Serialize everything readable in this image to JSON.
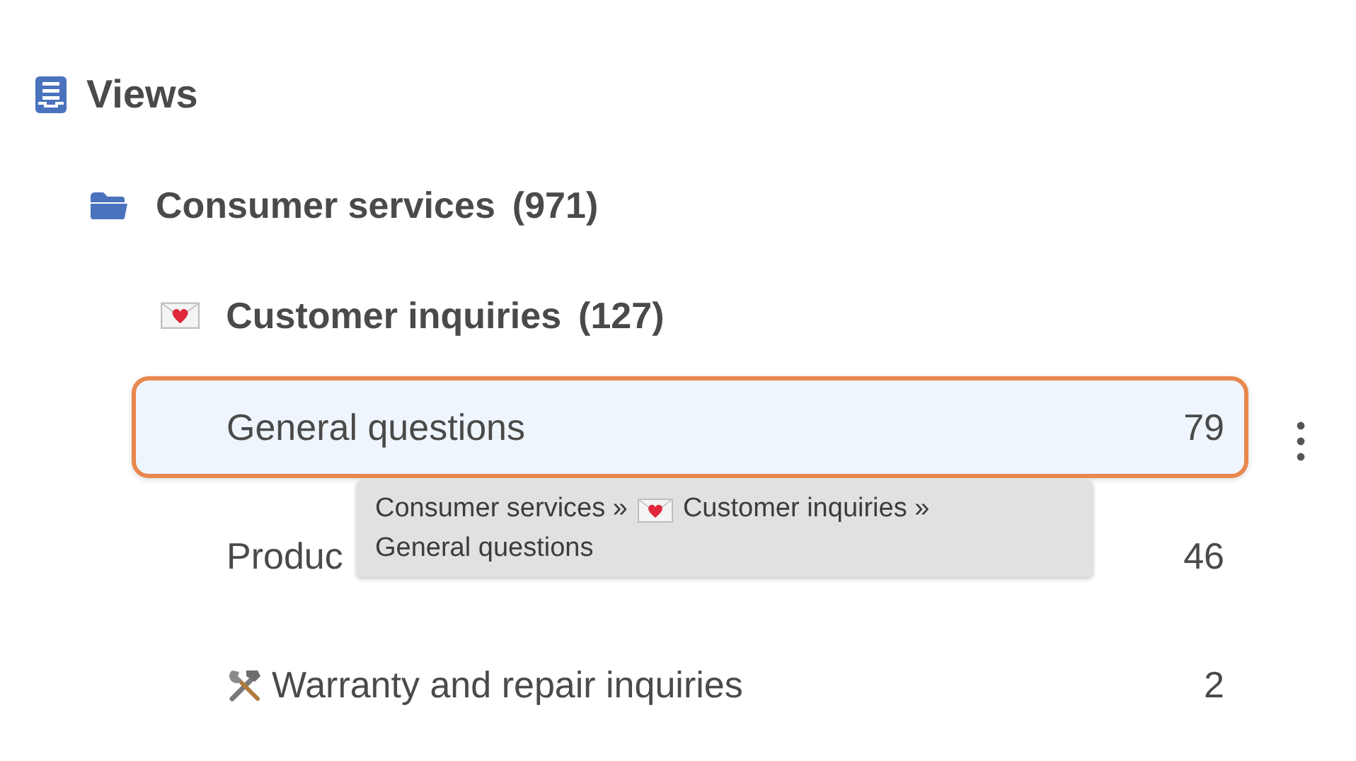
{
  "views": {
    "label": "Views",
    "children": [
      {
        "kind": "folder",
        "label": "Consumer services",
        "count": "(971)",
        "children": [
          {
            "kind": "category",
            "label": "Customer inquiries",
            "count": "(127)",
            "children": [
              {
                "kind": "view",
                "label": "General questions",
                "count": "79",
                "selected": true
              },
              {
                "kind": "view",
                "label": "Produc",
                "count": "46",
                "selected": false
              },
              {
                "kind": "repair-view",
                "label": "Warranty and repair inquiries",
                "count": "2",
                "selected": false
              }
            ]
          }
        ]
      }
    ]
  },
  "tooltip": {
    "segments": [
      {
        "kind": "text",
        "text": "Consumer services »"
      },
      {
        "kind": "category",
        "text": "Customer inquiries »"
      },
      {
        "kind": "text",
        "text": "General questions"
      }
    ]
  }
}
